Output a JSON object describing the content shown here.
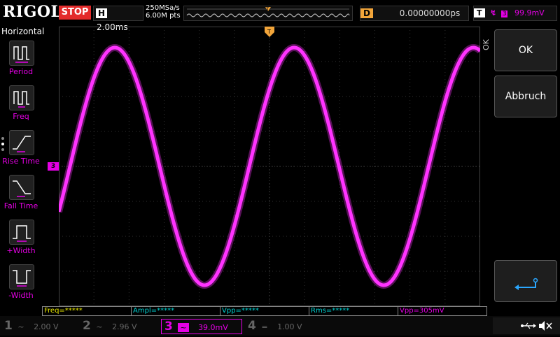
{
  "header": {
    "logo": "RIGOL",
    "run_state": "STOP",
    "horizontal": {
      "label": "H",
      "value": "2.00ms"
    },
    "sample_rate": "250MSa/s",
    "memory_depth": "6.00M pts",
    "delay": {
      "label": "D",
      "value": "0.00000000ps"
    },
    "trigger": {
      "label": "T",
      "channel": "3",
      "level": "99.9mV"
    }
  },
  "left_panel": {
    "title": "Horizontal",
    "items": [
      {
        "label": "Period",
        "icon": "period-icon"
      },
      {
        "label": "Freq",
        "icon": "freq-icon"
      },
      {
        "label": "Rise Time",
        "icon": "rise-time-icon"
      },
      {
        "label": "Fall Time",
        "icon": "fall-time-icon"
      },
      {
        "label": "+Width",
        "icon": "pos-width-icon"
      },
      {
        "label": "-Width",
        "icon": "neg-width-icon"
      }
    ]
  },
  "right_panel": {
    "ok_label": "OK",
    "cancel_label": "Abbruch",
    "ok_side_label": "OK",
    "enter_icon": "enter-icon"
  },
  "measurements": [
    {
      "text": "Freq=*****",
      "color": "#e8e800"
    },
    {
      "text": "Ampl=*****",
      "color": "#00d4d4"
    },
    {
      "text": "Vpp=*****",
      "color": "#00d4d4"
    },
    {
      "text": "Rms=*****",
      "color": "#00d4d4"
    },
    {
      "text": "Vpp=305mV",
      "color": "#e500e5"
    }
  ],
  "channels": [
    {
      "num": "1",
      "coupling": "~",
      "scale": "2.00 V",
      "color": "#555555",
      "active": false
    },
    {
      "num": "2",
      "coupling": "~",
      "scale": "2.96 V",
      "color": "#555555",
      "active": false
    },
    {
      "num": "3",
      "coupling": "~",
      "scale": "39.0mV",
      "color": "#e500e5",
      "active": true
    },
    {
      "num": "4",
      "coupling": "=",
      "scale": "1.00 V",
      "color": "#555555",
      "active": false
    }
  ],
  "colors": {
    "trace": "#ff33ff",
    "trigger_marker": "#f2a53a",
    "grid": "#333333"
  },
  "waveform": {
    "type": "sine",
    "cycles_on_screen": 2.35,
    "center_level": "Channel 3 offset marker",
    "marker_label": "3"
  }
}
